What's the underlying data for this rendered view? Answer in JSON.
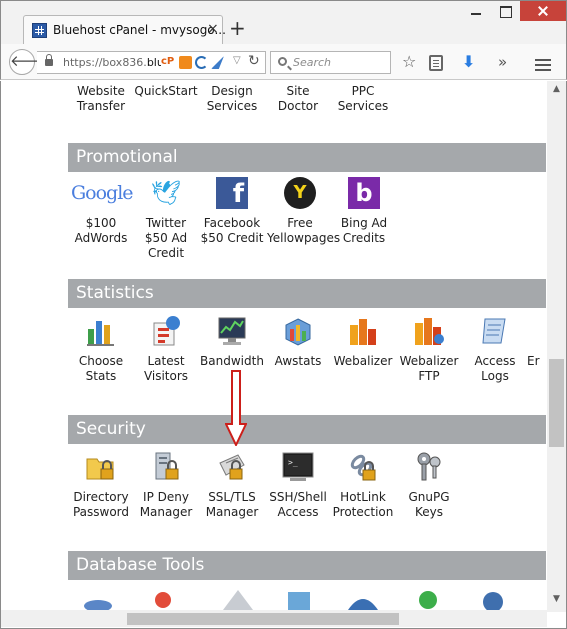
{
  "browser": {
    "tab_title": "Bluehost cPanel - mvysogo...",
    "tab_close": "×",
    "new_tab": "+",
    "url": "https://box836.blue",
    "url_prefix": "https://box836.",
    "url_host": "blue",
    "cp_badge": "cP",
    "search_placeholder": "Search",
    "back_glyph": "🡐",
    "reload_glyph": "↻",
    "dropdown_glyph": "▽",
    "star_glyph": "☆",
    "download_glyph": "⬇",
    "more_glyph": "»",
    "icons": [
      "favicon-grid-icon",
      "lock-icon",
      "cpanel-icon",
      "extension-icon",
      "reload-icon",
      "search-icon",
      "star-icon",
      "reading-list-icon",
      "download-icon",
      "overflow-icon",
      "hamburger-menu-icon"
    ]
  },
  "top_row": {
    "items": [
      {
        "label1": "Website",
        "label2": "Transfer"
      },
      {
        "label1": "QuickStart",
        "label2": ""
      },
      {
        "label1": "Design",
        "label2": "Services"
      },
      {
        "label1": "Site",
        "label2": "Doctor"
      },
      {
        "label1": "PPC",
        "label2": "Services"
      }
    ]
  },
  "promotional": {
    "title": "Promotional",
    "google_logo": "Google",
    "fb_glyph": "f",
    "yp_glyph": "Y",
    "bing_glyph": "b",
    "tw_glyph": "🕊",
    "items": [
      {
        "label1": "$100",
        "label2": "AdWords",
        "label3": "",
        "icon": "google-icon"
      },
      {
        "label1": "Twitter",
        "label2": "$50 Ad",
        "label3": "Credit",
        "icon": "twitter-icon"
      },
      {
        "label1": "Facebook",
        "label2": "$50 Credit",
        "label3": "",
        "icon": "facebook-icon"
      },
      {
        "label1": "Free",
        "label2": "Yellowpages",
        "label3": "",
        "icon": "yellowpages-icon"
      },
      {
        "label1": "Bing Ad",
        "label2": "Credits",
        "label3": "",
        "icon": "bing-icon"
      }
    ]
  },
  "statistics": {
    "title": "Statistics",
    "items": [
      {
        "label1": "Choose",
        "label2": "Stats",
        "icon": "stats-chart-icon"
      },
      {
        "label1": "Latest",
        "label2": "Visitors",
        "icon": "visitors-icon"
      },
      {
        "label1": "Bandwidth",
        "label2": "",
        "icon": "bandwidth-icon"
      },
      {
        "label1": "Awstats",
        "label2": "",
        "icon": "awstats-icon"
      },
      {
        "label1": "Webalizer",
        "label2": "",
        "icon": "webalizer-icon"
      },
      {
        "label1": "Webalizer",
        "label2": "FTP",
        "icon": "webalizer-ftp-icon"
      },
      {
        "label1": "Access",
        "label2": "Logs",
        "icon": "access-logs-icon"
      },
      {
        "label1": "Er",
        "label2": "",
        "icon": "error-logs-icon"
      }
    ]
  },
  "security": {
    "title": "Security",
    "items": [
      {
        "label1": "Directory",
        "label2": "Password",
        "icon": "folder-lock-icon"
      },
      {
        "label1": "IP Deny",
        "label2": "Manager",
        "icon": "ip-deny-icon"
      },
      {
        "label1": "SSL/TLS",
        "label2": "Manager",
        "icon": "ssl-certificate-icon"
      },
      {
        "label1": "SSH/Shell",
        "label2": "Access",
        "icon": "terminal-icon"
      },
      {
        "label1": "HotLink",
        "label2": "Protection",
        "icon": "hotlink-icon"
      },
      {
        "label1": "GnuPG",
        "label2": "Keys",
        "icon": "keys-icon"
      }
    ]
  },
  "database": {
    "title": "Database Tools"
  },
  "annotation": {
    "arrow_color": "#cc1f1a"
  },
  "colors": {
    "section_header": "#a5a8ab",
    "window_close": "#c7433a",
    "download_accent": "#2a7de1"
  }
}
